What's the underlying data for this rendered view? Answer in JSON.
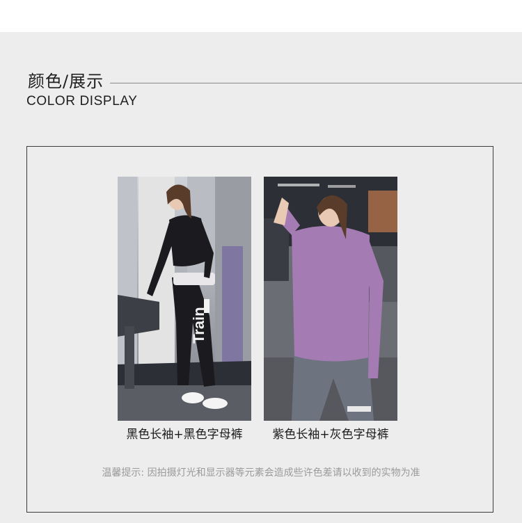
{
  "section": {
    "title_cn": "颜色/展示",
    "title_en": "COLOR DISPLAY"
  },
  "products": [
    {
      "caption": "黑色长袖+黑色字母裤",
      "print_text": "Train"
    },
    {
      "caption": "紫色长袖+灰色字母裤"
    }
  ],
  "notice": "温馨提示: 因拍摄灯光和显示器等元素会造成些许色差请以收到的实物为准",
  "colors": {
    "background": "#ededed",
    "top_band": "#ffffff",
    "frame_border": "#3a3a3a",
    "notice_text": "#9a9a9a",
    "outfit_black": "#1b1b1f",
    "outfit_purple": "#a57bb3",
    "pants_grey": "#6e7380"
  }
}
